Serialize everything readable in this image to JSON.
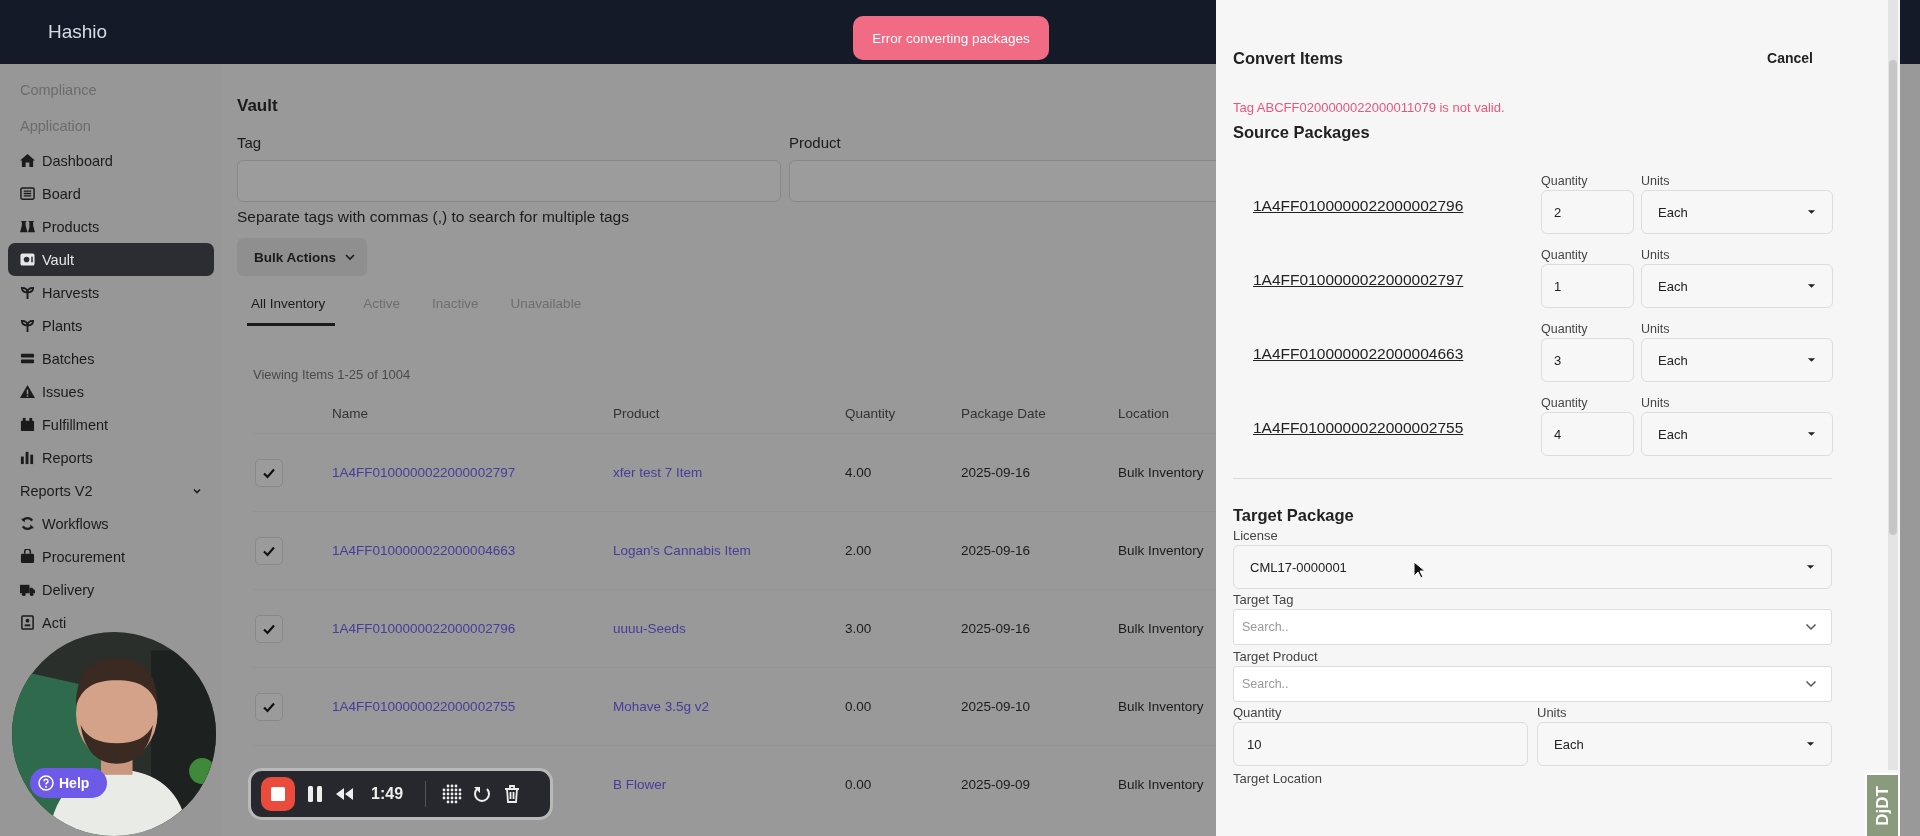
{
  "app": {
    "name": "Hashio"
  },
  "toast": {
    "text": "Error converting packages"
  },
  "sidebar": {
    "sections": [
      "Compliance",
      "Application"
    ],
    "items": [
      {
        "kind": "link",
        "label": "Dashboard",
        "selected": false
      },
      {
        "kind": "link",
        "label": "Board",
        "selected": false
      },
      {
        "kind": "link",
        "label": "Products",
        "selected": false
      },
      {
        "kind": "link",
        "label": "Vault",
        "selected": true
      },
      {
        "kind": "link",
        "label": "Harvests",
        "selected": false
      },
      {
        "kind": "link",
        "label": "Plants",
        "selected": false
      },
      {
        "kind": "link",
        "label": "Batches",
        "selected": false
      },
      {
        "kind": "link",
        "label": "Issues",
        "selected": false
      },
      {
        "kind": "link",
        "label": "Fulfillment",
        "selected": false
      },
      {
        "kind": "link",
        "label": "Reports",
        "selected": false
      },
      {
        "kind": "group",
        "label": "Reports V2",
        "selected": false
      },
      {
        "kind": "link",
        "label": "Workflows",
        "selected": false
      },
      {
        "kind": "link",
        "label": "Procurement",
        "selected": false
      },
      {
        "kind": "link",
        "label": "Delivery",
        "selected": false
      },
      {
        "kind": "link",
        "label": "Acti",
        "selected": false
      }
    ]
  },
  "page": {
    "title": "Vault",
    "filters": [
      {
        "label": "Tag"
      },
      {
        "label": "Product"
      }
    ],
    "hint": "Separate tags with commas (,) to search for multiple tags",
    "bulk_button": "Bulk Actions",
    "tabs": [
      {
        "label": "All Inventory",
        "selected": true
      },
      {
        "label": "Active",
        "selected": false
      },
      {
        "label": "Inactive",
        "selected": false
      },
      {
        "label": "Unavailable",
        "selected": false
      }
    ],
    "count": "Viewing Items 1-25 of 1004"
  },
  "table": {
    "columns": [
      "Name",
      "Product",
      "Quantity",
      "Package Date",
      "Location"
    ],
    "rows": [
      {
        "checked": true,
        "name": "1A4FF0100000022000002797",
        "product": "xfer test 7 Item",
        "quantity": "4.00",
        "date": "2025-09-16",
        "location": "Bulk Inventory"
      },
      {
        "checked": true,
        "name": "1A4FF0100000022000004663",
        "product": "Logan's Cannabis Item",
        "quantity": "2.00",
        "date": "2025-09-16",
        "location": "Bulk Inventory"
      },
      {
        "checked": true,
        "name": "1A4FF0100000022000002796",
        "product": "uuuu-Seeds",
        "quantity": "3.00",
        "date": "2025-09-16",
        "location": "Bulk Inventory"
      },
      {
        "checked": true,
        "name": "1A4FF0100000022000002755",
        "product": "Mohave 3.5g v2",
        "quantity": "0.00",
        "date": "2025-09-10",
        "location": "Bulk Inventory"
      },
      {
        "product": "B Flower",
        "quantity": "0.00",
        "date": "2025-09-09",
        "location": "Bulk Inventory"
      }
    ]
  },
  "convert_panel": {
    "title": "Convert Items",
    "cancel": "Cancel",
    "error": "Tag ABCFF0200000022000011079 is not valid.",
    "source_title": "Source Packages",
    "sources": [
      {
        "tag": "1A4FF0100000022000002796",
        "quantity_label": "Quantity",
        "quantity": "2",
        "units_label": "Units",
        "units": "Each"
      },
      {
        "tag": "1A4FF0100000022000002797",
        "quantity_label": "Quantity",
        "quantity": "1",
        "units_label": "Units",
        "units": "Each"
      },
      {
        "tag": "1A4FF0100000022000004663",
        "quantity_label": "Quantity",
        "quantity": "3",
        "units_label": "Units",
        "units": "Each"
      },
      {
        "tag": "1A4FF0100000022000002755",
        "quantity_label": "Quantity",
        "quantity": "4",
        "units_label": "Units",
        "units": "Each"
      }
    ],
    "target_title": "Target Package",
    "target_fields": [
      {
        "kind": "select",
        "label": "License",
        "value": "CML17-0000001"
      },
      {
        "kind": "search",
        "label": "Target Tag",
        "placeholder": "Search.."
      },
      {
        "kind": "search",
        "label": "Target Product",
        "placeholder": "Search.."
      }
    ],
    "quantity": {
      "label": "Quantity",
      "value": "10"
    },
    "units": {
      "label": "Units",
      "value": "Each"
    },
    "location_label": "Target Location"
  },
  "help": {
    "label": "Help"
  },
  "recorder": {
    "time": "1:49"
  },
  "debug_toolbar": {
    "label": "DjDT"
  }
}
